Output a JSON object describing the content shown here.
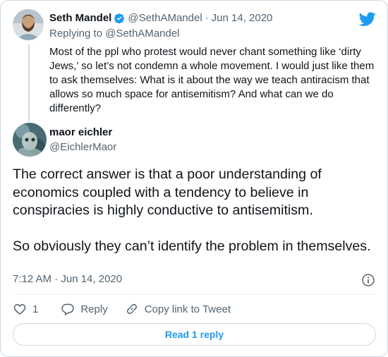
{
  "parent_tweet": {
    "author_name": "Seth Mandel",
    "author_handle": "@SethAMandel",
    "separator": "·",
    "date": "Jun 14, 2020",
    "replying_to": "Replying to @SethAMandel",
    "text": "Most of the ppl who protest would never chant something like ‘dirty Jews,’ so let’s not condemn a whole movement. I would just like them to ask themselves: What is it about the way we teach antiracism that allows so much space for antisemitism? And what can we do differently?",
    "verified_icon": "verified-badge-icon",
    "avatar_icon": "avatar"
  },
  "tweet": {
    "author_name": "maor eichler",
    "author_handle": "@EichlerMaor",
    "text": "The correct answer is that a poor understanding of economics coupled with a tendency to believe in conspiracies is highly conductive to antisemitism.\n\nSo obviously they can’t identify the problem in themselves.",
    "timestamp": "7:12 AM · Jun 14, 2020"
  },
  "actions": {
    "like_count": "1",
    "reply_label": "Reply",
    "copy_link_label": "Copy link to Tweet"
  },
  "read_replies_label": "Read 1 reply",
  "colors": {
    "brand": "#1d9bf0",
    "secondary_text": "#536471",
    "primary_text": "#0f1419",
    "border": "#cfd9de"
  }
}
